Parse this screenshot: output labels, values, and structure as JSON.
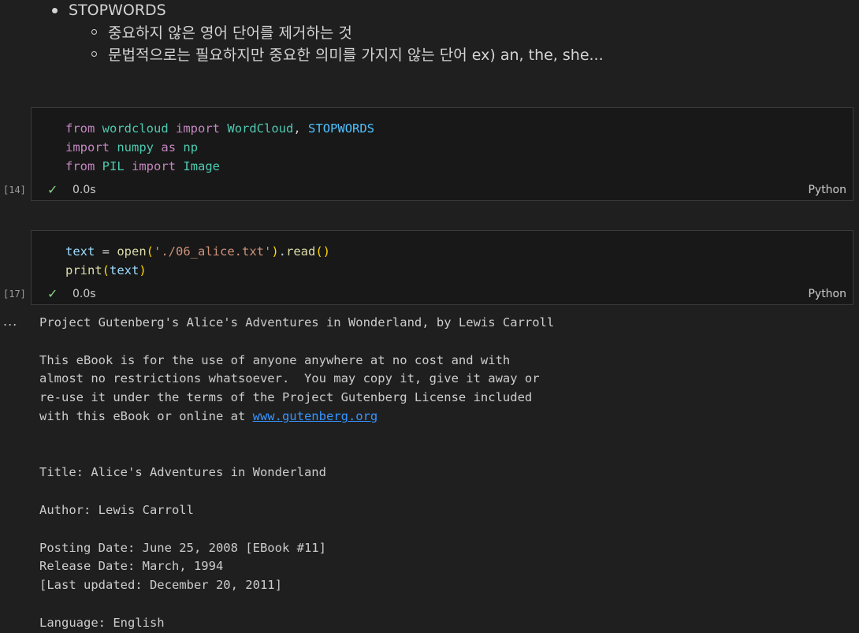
{
  "markdown": {
    "heading_bullet": "STOPWORDS",
    "sub_bullets": [
      "중요하지 않은 영어 단어를 제거하는 것",
      "문법적으로는 필요하지만 중요한 의미를 가지지 않는 단어 ex) an, the, she..."
    ]
  },
  "cell1": {
    "exec_count": "[14]",
    "time": "0.0s",
    "language": "Python",
    "line1": {
      "from": "from",
      "module": "wordcloud",
      "import": "import",
      "cls": "WordCloud",
      "sep": ", ",
      "const": "STOPWORDS"
    },
    "line2": {
      "import": "import",
      "module": "numpy",
      "as": "as",
      "alias": "np"
    },
    "line3": {
      "from": "from",
      "module": "PIL",
      "import": "import",
      "cls": "Image"
    }
  },
  "cell2": {
    "exec_count": "[17]",
    "time": "0.0s",
    "language": "Python",
    "line1": {
      "var": "text",
      "eq": " = ",
      "fn": "open",
      "lp": "(",
      "str": "'./06_alice.txt'",
      "rp": ")",
      "dot": ".",
      "fn2": "read",
      "parens": "()"
    },
    "line2": {
      "fn": "print",
      "lp": "(",
      "var": "text",
      "rp": ")"
    }
  },
  "output": {
    "more_icon": "...",
    "lines": [
      "Project Gutenberg's Alice's Adventures in Wonderland, by Lewis Carroll",
      "",
      "This eBook is for the use of anyone anywhere at no cost and with",
      "almost no restrictions whatsoever.  You may copy it, give it away or",
      "re-use it under the terms of the Project Gutenberg License included"
    ],
    "line_with_link_prefix": "with this eBook or online at ",
    "link": "www.gutenberg.org",
    "lines_after": [
      "",
      "",
      "Title: Alice's Adventures in Wonderland",
      "",
      "Author: Lewis Carroll",
      "",
      "Posting Date: June 25, 2008 [EBook #11]",
      "Release Date: March, 1994",
      "[Last updated: December 20, 2011]",
      "",
      "Language: English"
    ]
  }
}
